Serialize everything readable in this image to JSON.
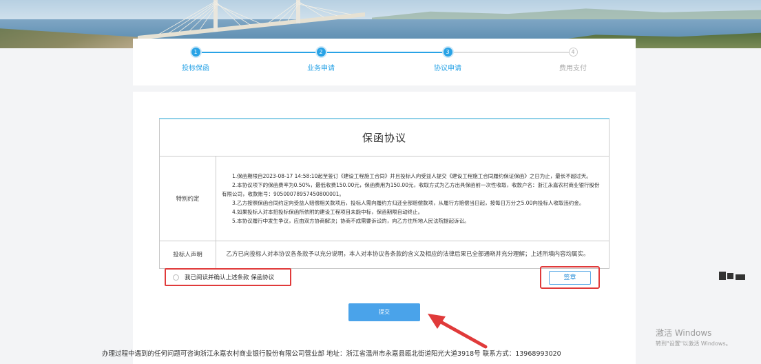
{
  "steps": [
    {
      "number": "1",
      "label": "投标保函",
      "state": "active"
    },
    {
      "number": "2",
      "label": "业务申请",
      "state": "active"
    },
    {
      "number": "3",
      "label": "协议申请",
      "state": "active"
    },
    {
      "number": "4",
      "label": "费用支付",
      "state": "inactive"
    }
  ],
  "agreement": {
    "title": "保函协议",
    "special_terms_label": "特别约定",
    "terms": [
      "1.保函期限自2023-08-17 14:58:10起至鉴订《建设工程施工合同》并且投标人向受益人提交《建设工程施工合同履约保证保函》之日为止，最长不超过天。",
      "2.本协议项下的保函费率为0.50%，最低收费150.00元，保函费用为150.00元，收取方式为乙方出具保函前一次性收取，收款户名：浙江永嘉农村商业银行股份有限公司，收款账号：90500078957450800001。",
      "3.乙方按照保函合同约定向受益人赔偿相关款项后，投标人需向履约方归还全部赔偿款项，从履行方赔偿当日起，按每日万分之5.00向投标人收取违约金。",
      "4.如果投标人对本招投标保函所依附的建设工程项目未能中标，保函期限自动终止。",
      "5.本协议履行中发生争议，应由双方协商解决；协商不成需要诉讼的，向乙方住所地人民法院提起诉讼。"
    ],
    "declaration_label": "投标人声明",
    "declaration_text": "乙方已向投标人对本协议各条款予以充分说明，本人对本协议各条款的含义及相应的法律后果已全部通晓并充分理解；上述所填内容均属实。"
  },
  "agree_checkbox_label": "我已阅读并确认上述条款 保函协议",
  "sign_button": "签章",
  "submit_button": "提交",
  "footer": "办理过程中遇到的任何问题可咨询浙江永嘉农村商业银行股份有限公司营业部 地址：浙江省温州市永嘉县瓯北街道阳光大道3918号 联系方式：13968993020",
  "windows_watermark": {
    "line1": "激活 Windows",
    "line2": "转到\"设置\"以激活 Windows。"
  },
  "colors": {
    "accent": "#29a3e6",
    "highlight_red": "#e03a3a",
    "submit_blue": "#4aa3ea"
  }
}
